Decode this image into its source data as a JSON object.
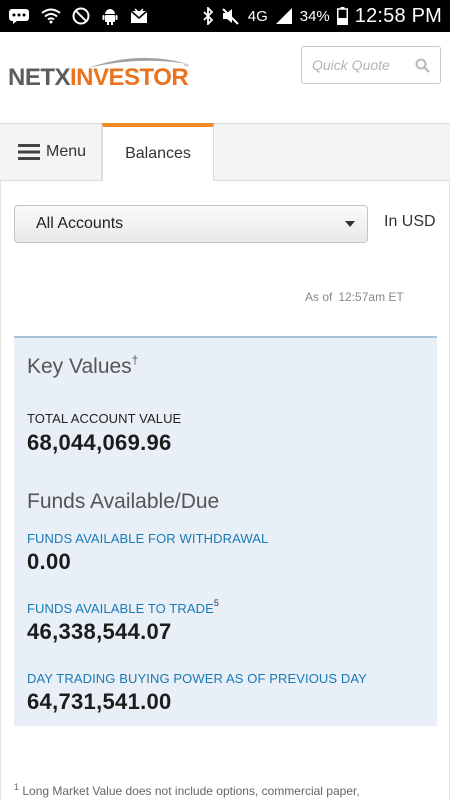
{
  "status_bar": {
    "battery_percent": "34%",
    "network": "4G",
    "time": "12:58 PM"
  },
  "header": {
    "logo_primary": "NETX",
    "logo_secondary": "INVESTOR",
    "logo_tm": "™",
    "quote_placeholder": "Quick Quote",
    "colors": {
      "logo_gray": "#5b5e61",
      "logo_orange": "#e9731f",
      "tab_accent": "#f08a24",
      "link_blue": "#1a7ab5"
    }
  },
  "tabs": {
    "menu_label": "Menu",
    "active_label": "Balances"
  },
  "main": {
    "account_selected": "All Accounts",
    "currency": "In USD",
    "as_of_label": "As of",
    "as_of_time": "12:57am ET"
  },
  "key_values": {
    "heading": "Key Values",
    "heading_mark": "†",
    "total_label": "TOTAL ACCOUNT VALUE",
    "total_value": "68,044,069.96"
  },
  "funds": {
    "heading": "Funds Available/Due",
    "withdrawal_label": "FUNDS AVAILABLE FOR WITHDRAWAL",
    "withdrawal_value": "0.00",
    "trade_label": "FUNDS AVAILABLE TO TRADE",
    "trade_footnote": "5",
    "trade_value": "46,338,544.07",
    "daytrade_label": "DAY TRADING BUYING POWER AS OF PREVIOUS DAY",
    "daytrade_value": "64,731,541.00"
  },
  "footnote": {
    "mark": "1",
    "text": "Long Market Value does not include options, commercial paper,"
  }
}
